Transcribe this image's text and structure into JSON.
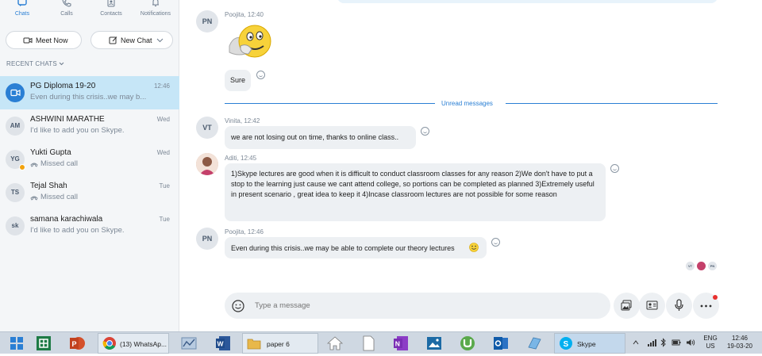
{
  "nav": [
    {
      "label": "Chats",
      "icon": "chat-icon"
    },
    {
      "label": "Calls",
      "icon": "phone-icon"
    },
    {
      "label": "Contacts",
      "icon": "contacts-icon"
    },
    {
      "label": "Notifications",
      "icon": "bell-icon"
    }
  ],
  "buttons": {
    "meet_now": "Meet Now",
    "new_chat": "New Chat"
  },
  "recent_label": "RECENT CHATS",
  "chats": [
    {
      "initials": "",
      "name": "PG Diploma 19-20",
      "preview": "Even during this crisis..we may b...",
      "date": "12:46"
    },
    {
      "initials": "AM",
      "name": "ASHWINI MARATHE",
      "preview": "I'd like to add you on Skype.",
      "date": "Wed"
    },
    {
      "initials": "YG",
      "name": "Yukti Gupta",
      "preview": "Missed call",
      "date": "Wed"
    },
    {
      "initials": "TS",
      "name": "Tejal Shah",
      "preview": "Missed call",
      "date": "Tue"
    },
    {
      "initials": "sk",
      "name": "samana karachiwala",
      "preview": "I'd like to add you on Skype.",
      "date": "Tue"
    }
  ],
  "messages": [
    {
      "initials": "PN",
      "meta": "Poojita, 12:40",
      "text": "Sure"
    },
    {
      "initials": "VT",
      "meta": "Vinita, 12:42",
      "text": "we are not losing out on time, thanks to online class.."
    },
    {
      "initials": "",
      "meta": "Aditi, 12:45",
      "text": "1)Skype lectures are good when it is difficult to conduct classroom classes for any reason 2)We don't have to put a stop to the learning just cause we cant attend college, so portions can be completed as planned 3)Extremely useful in present scenario , great idea to keep it 4)Incase classroom lectures are not possible for some reason"
    },
    {
      "initials": "PN",
      "meta": "Poojita, 12:46",
      "text": "Even during this crisis..we may be able to complete our theory lectures"
    }
  ],
  "unread_label": "Unread messages",
  "read_receipts": [
    "VT",
    "PN"
  ],
  "compose": {
    "placeholder": "Type a message"
  },
  "taskbar": {
    "whatsapp": "(13) WhatsAp...",
    "paper": "paper 6",
    "skype": "Skype",
    "lang": "ENG",
    "region": "US",
    "time": "12:46",
    "date": "19-03-20"
  },
  "colors": {
    "accent": "#2a7fd4",
    "selected": "#c6e6f7",
    "sidebar": "#f4f6f8"
  }
}
